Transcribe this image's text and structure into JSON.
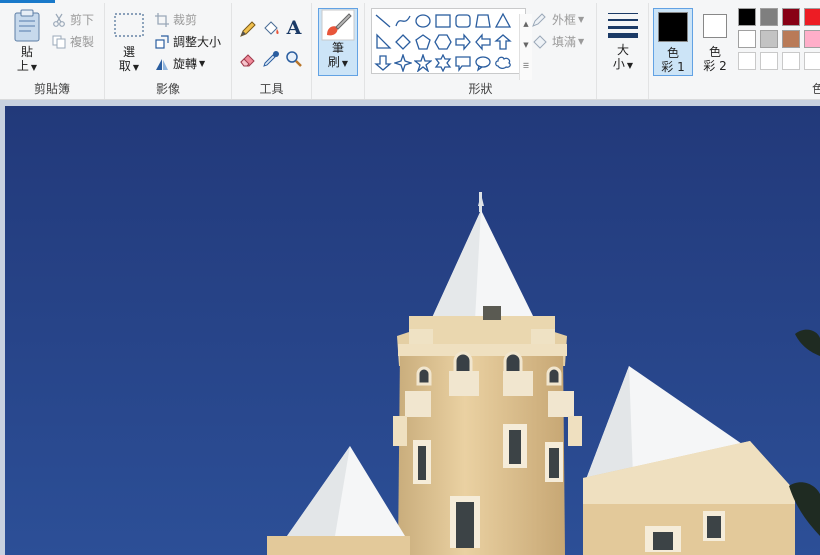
{
  "ribbon": {
    "clipboard": {
      "label": "剪貼簿",
      "paste_line1": "貼",
      "paste_line2": "上",
      "cut": "剪下",
      "copy": "複製"
    },
    "image": {
      "label": "影像",
      "select_line1": "選",
      "select_line2": "取",
      "crop": "裁剪",
      "resize": "調整大小",
      "rotate": "旋轉"
    },
    "tools": {
      "label": "工具",
      "text_tool_glyph": "A"
    },
    "brush": {
      "line1": "筆",
      "line2": "刷"
    },
    "shapes": {
      "label": "形狀",
      "outline": "外框",
      "fill": "填滿"
    },
    "size": {
      "line1": "大",
      "line2": "小"
    },
    "colors": {
      "color1_line1": "色",
      "color1_line2": "彩 1",
      "color2_line1": "色",
      "color2_line2": "彩 2",
      "label_partial": "色",
      "color1_value": "#000000",
      "color2_value": "#ffffff",
      "palette_row1": [
        "#000000",
        "#7f7f7f",
        "#880015",
        "#ed1c24"
      ],
      "palette_row2": [
        "#ffffff",
        "#c3c3c3",
        "#b97a57",
        "#ffaec9"
      ],
      "palette_row3": [
        "#ffffff",
        "#ffffff",
        "#ffffff",
        "#ffffff"
      ]
    }
  },
  "canvas": {
    "sky_color": "#253f7e",
    "tower_color": "#e3c99a",
    "roof_color": "#f4f6f7"
  }
}
